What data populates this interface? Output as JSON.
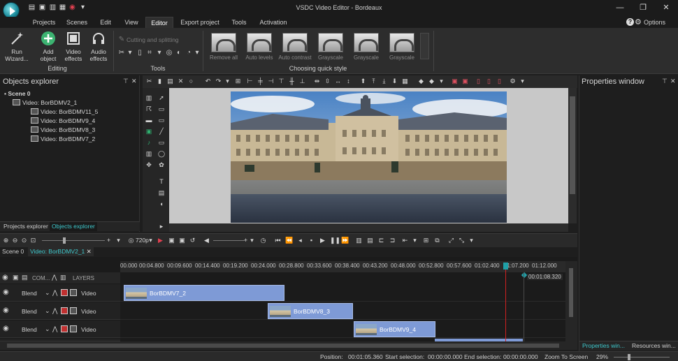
{
  "window": {
    "title": "VSDC Video Editor - Bordeaux",
    "quick_access": [
      "new-icon",
      "save-icon",
      "open-icon",
      "export-icon",
      "record-icon",
      "dropdown-icon"
    ]
  },
  "menu": {
    "items": [
      "Projects",
      "Scenes",
      "Edit",
      "View",
      "Editor",
      "Export project",
      "Tools",
      "Activation"
    ],
    "active": "Editor",
    "options_label": "Options"
  },
  "ribbon": {
    "run_wizard": "Run Wizard...",
    "add_object": "Add object",
    "video_effects": "Video effects",
    "audio_effects": "Audio effects",
    "editing_label": "Editing",
    "cutting_label": "Cutting and splitting",
    "tools_label": "Tools",
    "quick_styles": [
      "Remove all",
      "Auto levels",
      "Auto contrast",
      "Grayscale",
      "Grayscale",
      "Grayscale"
    ],
    "quick_style_label": "Choosing quick style"
  },
  "objects_explorer": {
    "title": "Objects explorer",
    "tree": [
      {
        "label": "Scene 0",
        "level": 0
      },
      {
        "label": "Video: BorBDMV2_1",
        "level": 1
      },
      {
        "label": "Video: BorBDMV11_5",
        "level": 2
      },
      {
        "label": "Video: BorBDMV9_4",
        "level": 2
      },
      {
        "label": "Video: BorBDMV8_3",
        "level": 2
      },
      {
        "label": "Video: BorBDMV7_2",
        "level": 2
      }
    ],
    "tabs": [
      "Projects explorer",
      "Objects explorer"
    ],
    "active_tab": "Objects explorer"
  },
  "properties": {
    "title": "Properties window",
    "tabs": [
      "Properties win...",
      "Resources win..."
    ]
  },
  "playback": {
    "resolution": "720p"
  },
  "timeline": {
    "tabs": [
      "Scene 0",
      "Video: BorBDMV2_1"
    ],
    "active_tab": "Video: BorBDMV2_1",
    "com_label": "COM...",
    "layers_label": "LAYERS",
    "ruler_ticks": [
      "00.000",
      "00:04.800",
      "00:09.600",
      "00:14.400",
      "00:19.200",
      "00:24.000",
      "00:28.800",
      "00:33.600",
      "00:38.400",
      "00:43.200",
      "00:48.000",
      "00:52.800",
      "00:57.600",
      "01:02.400",
      "01:07.200",
      "01:12.000"
    ],
    "cursor_time": "00:01:08.320",
    "tracks": [
      {
        "blend": "Blend",
        "type": "Video",
        "clip": "BorBDMV7_2"
      },
      {
        "blend": "Blend",
        "type": "Video",
        "clip": "BorBDMV8_3"
      },
      {
        "blend": "Blend",
        "type": "Video",
        "clip": "BorBDMV9_4"
      }
    ]
  },
  "status": {
    "position_label": "Position:",
    "position_value": "00:01:05.360",
    "start_label": "Start selection:",
    "start_value": "00:00:00.000",
    "end_label": "End selection:",
    "end_value": "00:00:00.000",
    "zoom_label": "Zoom To Screen",
    "zoom_value": "29%"
  },
  "colors": {
    "accent": "#1fa0a8",
    "clip": "#7e9ad6",
    "playhead": "#d02020"
  }
}
